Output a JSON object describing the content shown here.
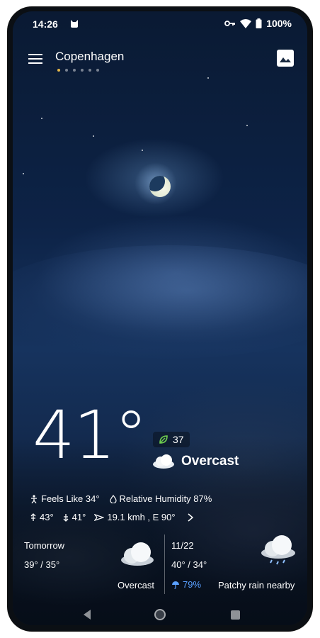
{
  "status_bar": {
    "time": "14:26",
    "battery": "100%",
    "icons": [
      "cat-icon",
      "vpn-key-icon",
      "wifi-icon",
      "battery-icon"
    ]
  },
  "header": {
    "city": "Copenhagen",
    "page_count": 6,
    "active_page": 1,
    "menu_icon": "hamburger-menu-icon",
    "wallpaper_icon": "image-icon"
  },
  "current": {
    "temperature": "41°",
    "aqi": "37",
    "condition": "Overcast",
    "feels_like": "Feels Like 34°",
    "humidity": "Relative Humidity 87%",
    "high": "43°",
    "low": "41°",
    "wind": "19.1 kmh , E 90°"
  },
  "forecast": {
    "tomorrow": {
      "label": "Tomorrow",
      "temps": "39° / 35°",
      "condition": "Overcast"
    },
    "next": {
      "date": "11/22",
      "temps": "40° / 34°",
      "precip": "79%",
      "condition": "Patchy rain nearby"
    }
  },
  "colors": {
    "accent_dot": "#e6b84a",
    "precip": "#5aa0ff",
    "sky_top": "#0a1a33",
    "sky_mid": "#16335e"
  }
}
